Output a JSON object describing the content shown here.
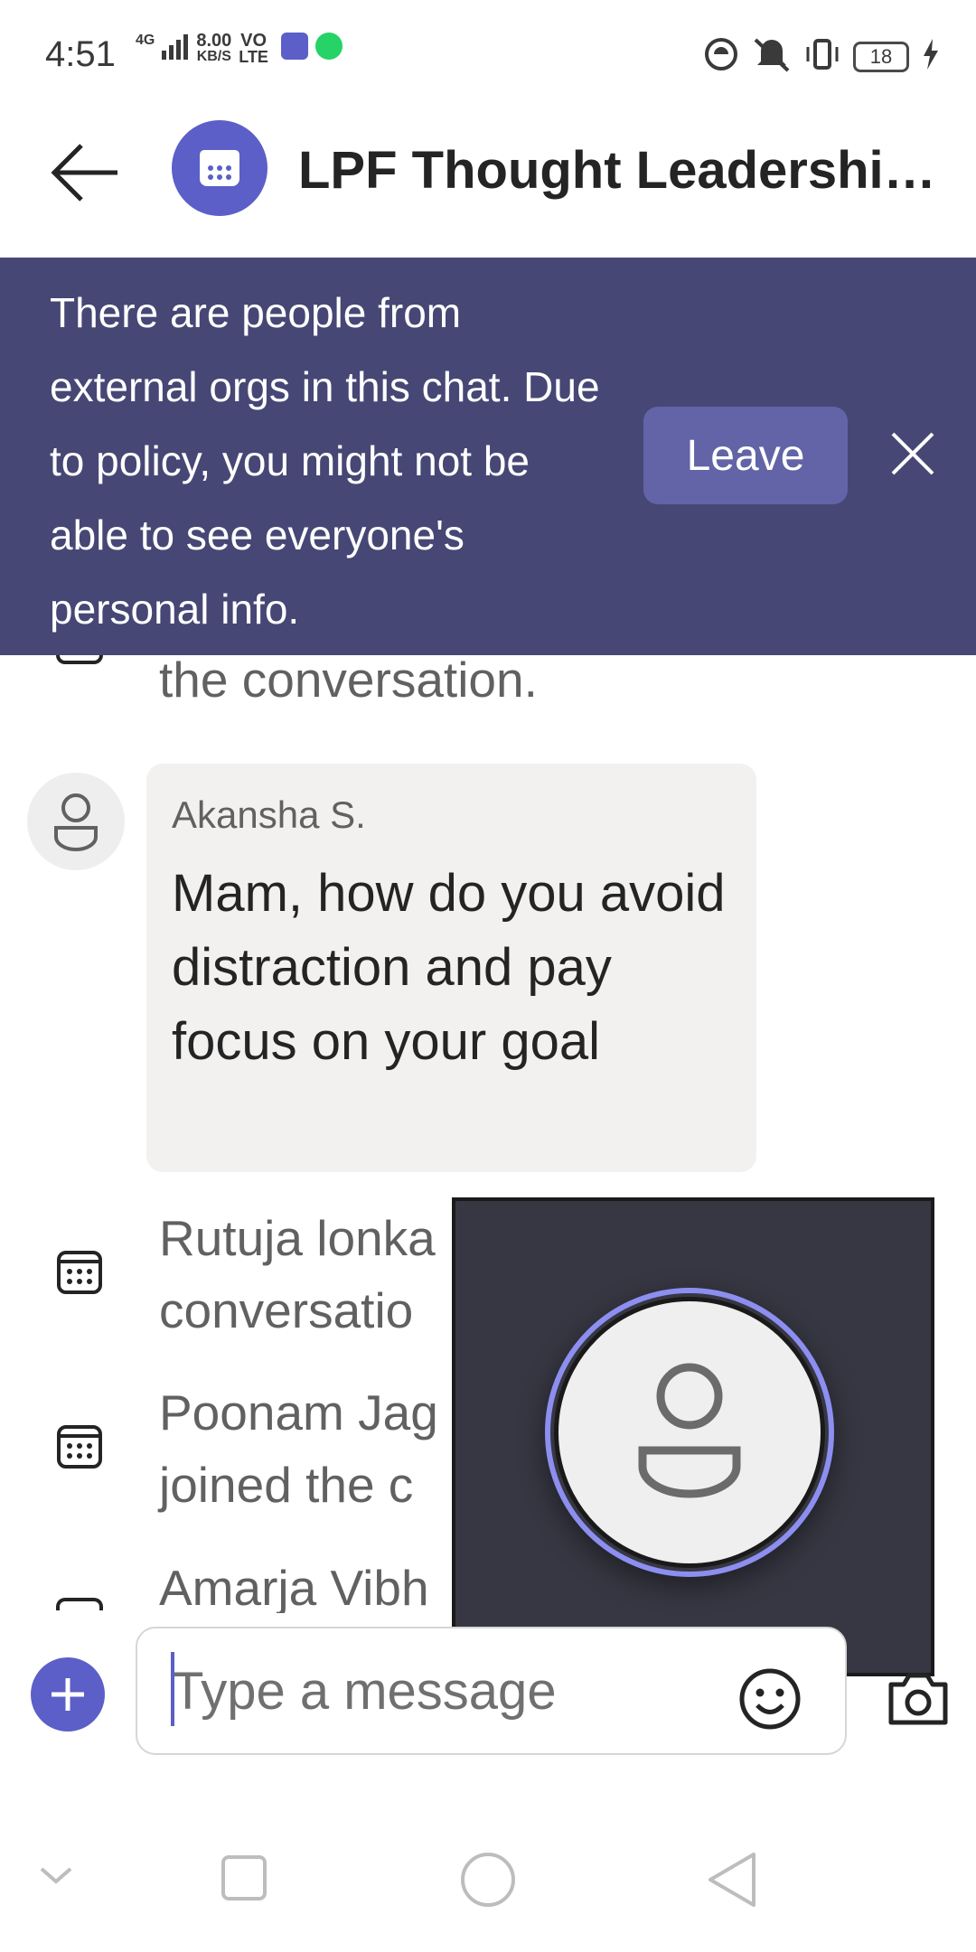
{
  "status_bar": {
    "time": "4:51",
    "network_speed": "8.00",
    "network_unit": "KB/S",
    "network_type": "4G",
    "volte": "VO",
    "volte_sub": "LTE",
    "battery": "18"
  },
  "header": {
    "title": "LPF Thought Leadership..."
  },
  "banner": {
    "message": "There are people from external orgs in this chat. Due to policy, you might not be able to see everyone's personal info.",
    "leave_label": "Leave"
  },
  "messages": {
    "system_top": "the conversation.",
    "akansha": {
      "sender": "Akansha S.",
      "text": "Mam, how do you avoid distraction and pay focus on your goal"
    },
    "system_rutuja_1": "Rutuja lonka",
    "system_rutuja_2": "conversatio",
    "system_poonam_1": "Poonam Jag",
    "system_poonam_2": "joined the c",
    "system_amarja": "Amarja Vibh"
  },
  "compose": {
    "placeholder": "Type a message"
  },
  "colors": {
    "brand": "#5b5fc7",
    "banner_bg": "#464775",
    "leave_bg": "#6264a7",
    "video_bg": "#373743",
    "video_ring": "#8c8ff0"
  }
}
